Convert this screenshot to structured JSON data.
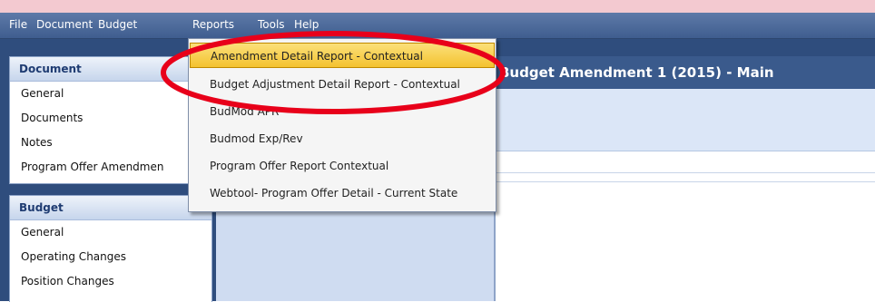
{
  "menubar": {
    "items": [
      "File",
      "Document",
      "Budget",
      "Reports",
      "Tools",
      "Help"
    ]
  },
  "nav": {
    "document": {
      "header": "Document",
      "items": [
        "General",
        "Documents",
        "Notes",
        "Program Offer Amendmen"
      ]
    },
    "budget": {
      "header": "Budget",
      "items": [
        "General",
        "Operating Changes",
        "Position Changes"
      ]
    }
  },
  "main": {
    "title": "Budget Amendment 1 (2015) - Main"
  },
  "reports_menu": {
    "items": [
      "Amendment Detail Report - Contextual",
      "Budget Adjustment Detail Report - Contextual",
      "BudMod APR",
      "Budmod Exp/Rev",
      "Program Offer Report Contextual",
      "Webtool- Program Offer Detail - Current State"
    ],
    "selected_index": 0
  },
  "colors": {
    "menubar": "#4a6799",
    "highlight": "#f4c22f",
    "annotation": "#e8001a"
  }
}
